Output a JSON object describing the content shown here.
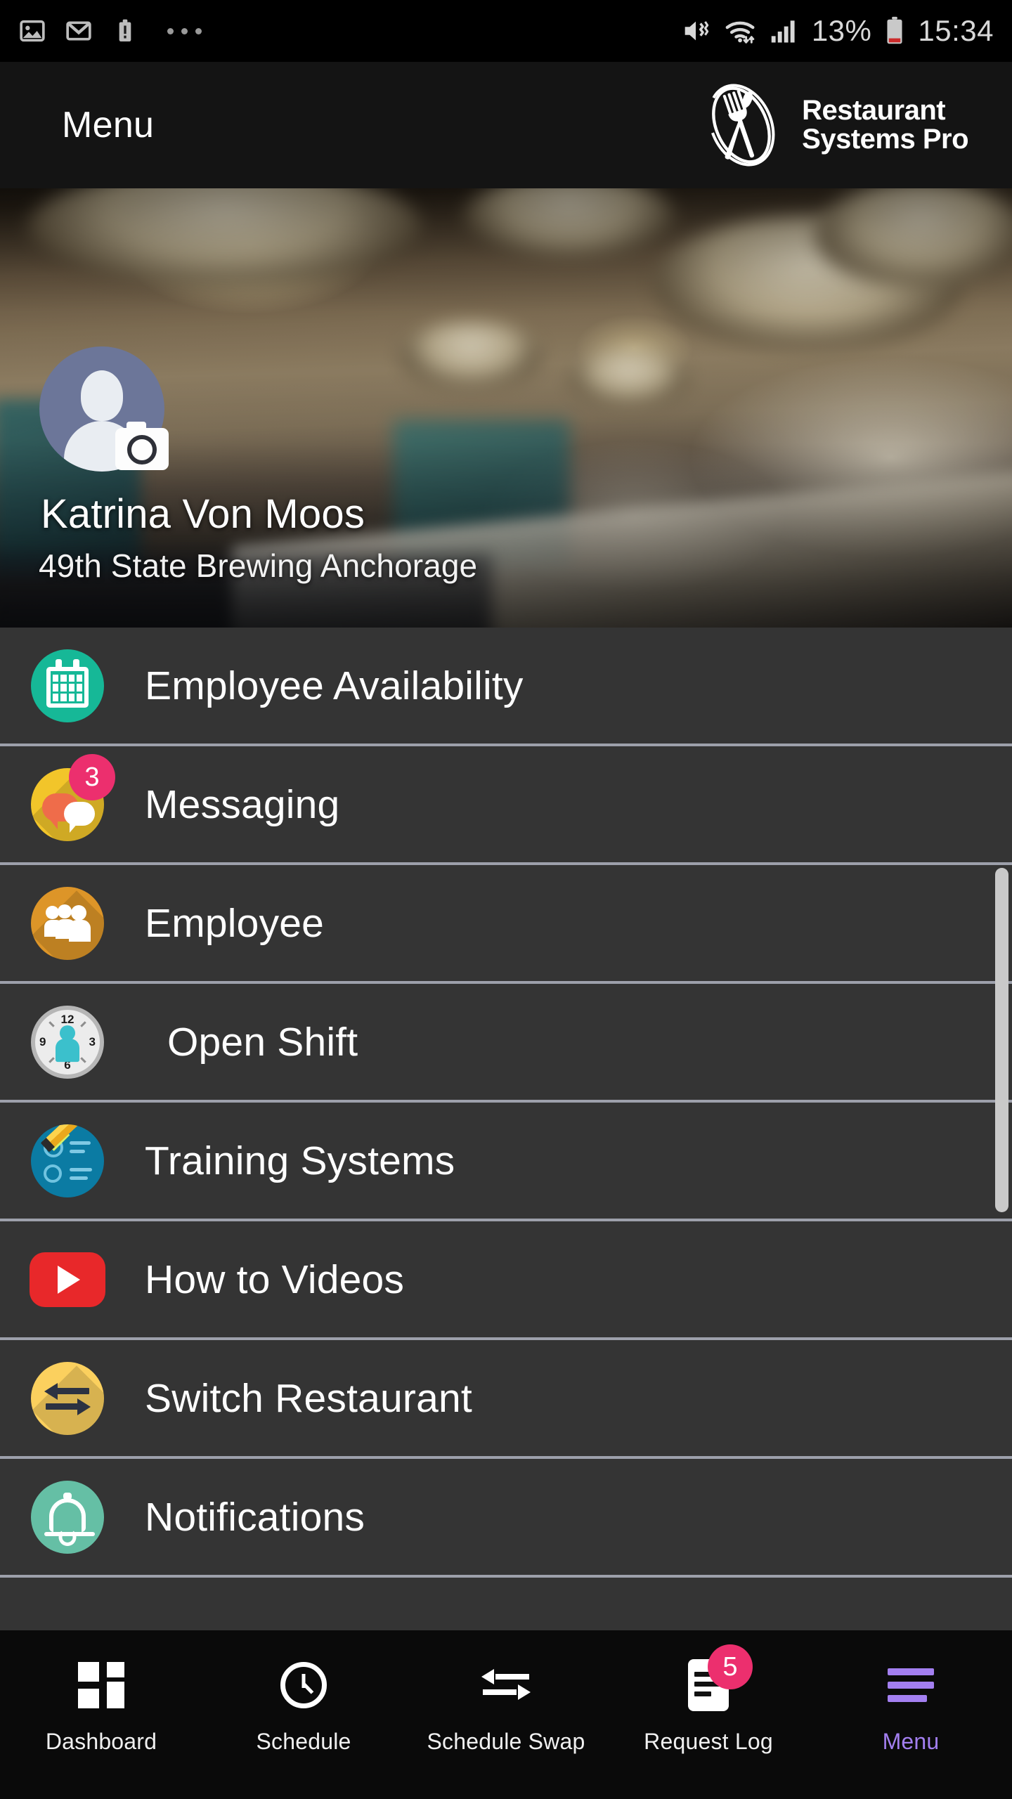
{
  "status_bar": {
    "left_icons": [
      "image-icon",
      "gmail-icon",
      "battery-alert-icon",
      "more-dots-icon"
    ],
    "right_icons": [
      "mute-vibrate-icon",
      "wifi-icon",
      "signal-bars-icon",
      "battery-icon"
    ],
    "battery_percent": "13%",
    "time": "15:34"
  },
  "app_bar": {
    "title": "Menu",
    "brand_line1": "Restaurant",
    "brand_line2": "Systems Pro",
    "brand_icon": "knife-fork-oval-logo"
  },
  "profile": {
    "name": "Katrina Von Moos",
    "restaurant": "49th State Brewing Anchorage",
    "avatar_icon": "person-avatar",
    "camera_badge_icon": "camera-icon"
  },
  "menu": {
    "items": [
      {
        "label": "Employee Availability",
        "icon": "calendar-icon",
        "color": "#16b897",
        "badge": null,
        "indented": false
      },
      {
        "label": "Messaging",
        "icon": "chat-bubbles-icon",
        "color": "#f2c52a",
        "badge": "3",
        "indented": false
      },
      {
        "label": "Employee",
        "icon": "people-icon",
        "color": "#dd9528",
        "badge": null,
        "indented": false
      },
      {
        "label": "Open Shift",
        "icon": "clock-person-icon",
        "color": "#ececec",
        "badge": null,
        "indented": true
      },
      {
        "label": "Training Systems",
        "icon": "checklist-pencil-icon",
        "color": "#0b7ba3",
        "badge": null,
        "indented": false
      },
      {
        "label": "How to Videos",
        "icon": "youtube-play-icon",
        "color": "#e8282a",
        "badge": null,
        "indented": false
      },
      {
        "label": "Switch Restaurant",
        "icon": "swap-arrows-icon",
        "color": "#fbd05e",
        "badge": null,
        "indented": false
      },
      {
        "label": "Notifications",
        "icon": "bell-icon",
        "color": "#65bfa5",
        "badge": null,
        "indented": false
      }
    ]
  },
  "clock_face": {
    "n12": "12",
    "n3": "3",
    "n6": "6",
    "n9": "9"
  },
  "bottom_nav": {
    "items": [
      {
        "label": "Dashboard",
        "icon": "dashboard-grid-icon",
        "badge": null,
        "active": false
      },
      {
        "label": "Schedule",
        "icon": "clock-icon",
        "badge": null,
        "active": false
      },
      {
        "label": "Schedule Swap",
        "icon": "swap-arrows-icon",
        "badge": null,
        "active": false
      },
      {
        "label": "Request Log",
        "icon": "document-icon",
        "badge": "5",
        "active": false
      },
      {
        "label": "Menu",
        "icon": "hamburger-menu-icon",
        "badge": null,
        "active": true
      }
    ]
  },
  "colors": {
    "accent_purple": "#a37ff0",
    "badge_pink": "#ec2f6e",
    "list_background": "#343434",
    "divider": "#9da0ab",
    "app_bar": "#141414",
    "nav_background": "#0a0a0a"
  }
}
